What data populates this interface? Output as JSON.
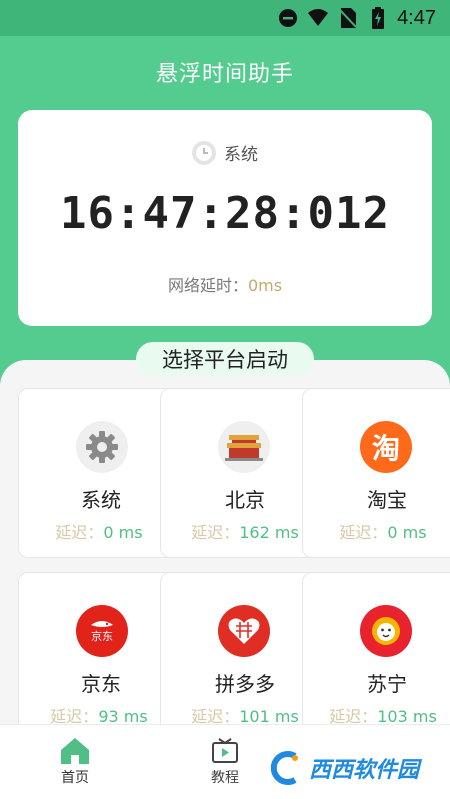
{
  "status_bar": {
    "time": "4:47"
  },
  "app": {
    "title": "悬浮时间助手"
  },
  "clock": {
    "source_label": "系统",
    "time": "16:47:28:012",
    "latency_label": "网络延时：",
    "latency_value": "0ms"
  },
  "section": {
    "title": "选择平台启动"
  },
  "platforms": [
    {
      "name": "系统",
      "delay_label": "延迟：",
      "delay_value": "0 ms",
      "icon": "gear-icon"
    },
    {
      "name": "北京",
      "delay_label": "延迟：",
      "delay_value": "162 ms",
      "icon": "palace-icon"
    },
    {
      "name": "淘宝",
      "delay_label": "延迟：",
      "delay_value": "0 ms",
      "icon": "taobao-logo",
      "logo_text": "淘",
      "color": "#ff6a1a"
    },
    {
      "name": "京东",
      "delay_label": "延迟：",
      "delay_value": "93 ms",
      "icon": "jd-logo",
      "logo_text": "京东",
      "color": "#e2231a"
    },
    {
      "name": "拼多多",
      "delay_label": "延迟：",
      "delay_value": "101 ms",
      "icon": "pdd-logo",
      "color": "#e02e24"
    },
    {
      "name": "苏宁",
      "delay_label": "延迟：",
      "delay_value": "103 ms",
      "icon": "suning-logo",
      "color": "#e8232e"
    }
  ],
  "tabs": [
    {
      "label": "首页",
      "icon": "home-icon",
      "active": true,
      "color": "#4fbf86"
    },
    {
      "label": "教程",
      "icon": "video-icon",
      "active": false
    }
  ],
  "watermark": {
    "text": "西西软件园"
  }
}
